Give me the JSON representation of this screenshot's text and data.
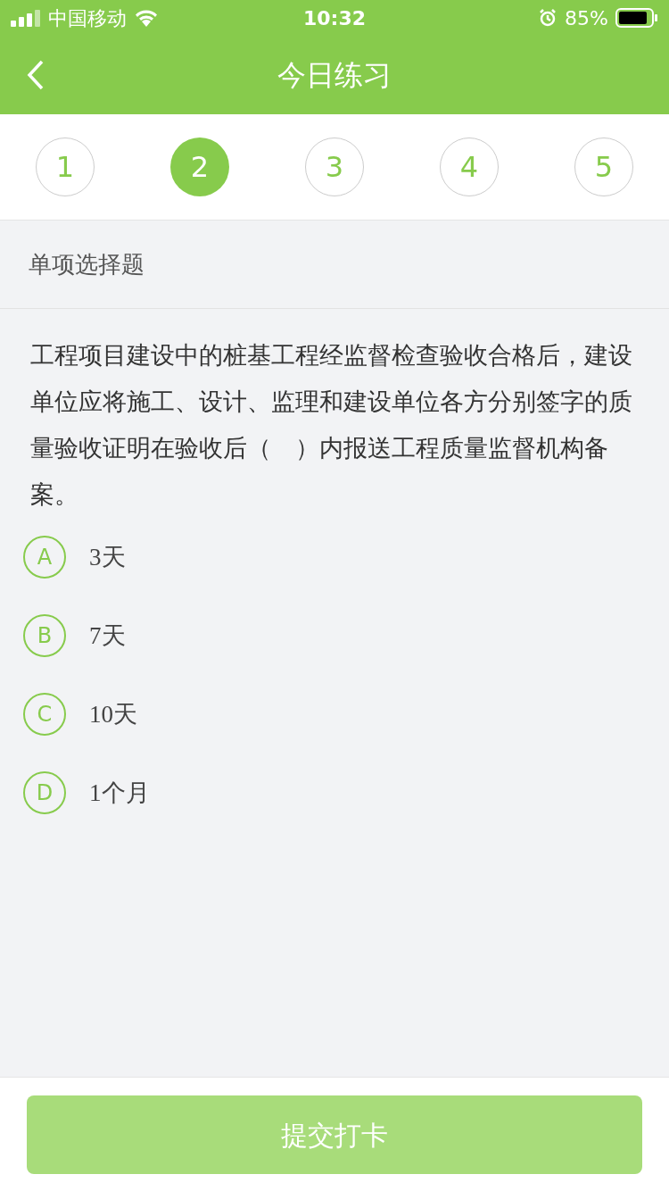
{
  "status_bar": {
    "carrier": "中国移动",
    "time": "10:32",
    "battery": "85%"
  },
  "nav": {
    "title": "今日练习"
  },
  "steps": [
    {
      "label": "1",
      "selected": false
    },
    {
      "label": "2",
      "selected": true
    },
    {
      "label": "3",
      "selected": false
    },
    {
      "label": "4",
      "selected": false
    },
    {
      "label": "5",
      "selected": false
    }
  ],
  "section": {
    "title": "单项选择题"
  },
  "question": {
    "text": "工程项目建设中的桩基工程经监督检查验收合格后，建设单位应将施工、设计、监理和建设单位各方分别签字的质量验收证明在验收后（　）内报送工程质量监督机构备案。"
  },
  "options": [
    {
      "letter": "A",
      "text": "3天",
      "selected": false
    },
    {
      "letter": "B",
      "text": "7天",
      "selected": false
    },
    {
      "letter": "C",
      "text": "10天",
      "selected": false
    },
    {
      "letter": "D",
      "text": "1个月",
      "selected": false
    }
  ],
  "submit": {
    "label": "提交打卡",
    "disabled": true
  }
}
